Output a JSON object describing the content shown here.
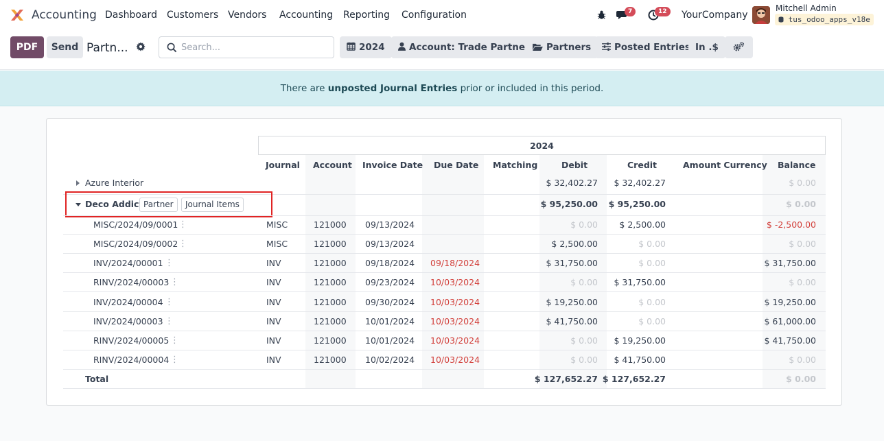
{
  "navbar": {
    "app_name": "Accounting",
    "menu": [
      "Dashboard",
      "Customers",
      "Vendors",
      "Accounting",
      "Reporting",
      "Configuration"
    ],
    "messages_count": "7",
    "activities_count": "12",
    "company": "YourCompany",
    "user": "Mitchell Admin",
    "database": "tus_odoo_apps_v18e"
  },
  "control_panel": {
    "pdf_label": "PDF",
    "send_label": "Send",
    "report_title": "Partn...",
    "search_placeholder": "Search...",
    "filters": {
      "date": "2024",
      "account": "Account: Trade Partners",
      "partners": "Partners",
      "posted": "Posted Entries",
      "currency": "In .$"
    }
  },
  "alert": {
    "prefix": "There are ",
    "bold": "unposted Journal Entries",
    "suffix": " prior or included in this period."
  },
  "report": {
    "period": "2024",
    "columns": [
      "Journal",
      "Account",
      "Invoice Date",
      "Due Date",
      "Matching",
      "Debit",
      "Credit",
      "Amount Currency",
      "Balance"
    ],
    "partners": [
      {
        "name": "Azure Interior",
        "debit": "$ 32,402.27",
        "credit": "$ 32,402.27",
        "balance": "$ 0.00"
      },
      {
        "name": "Deco Addict",
        "debit": "$ 95,250.00",
        "credit": "$ 95,250.00",
        "balance": "$ 0.00",
        "actions": [
          "Partner",
          "Journal Items"
        ]
      }
    ],
    "lines": [
      {
        "ref": "MISC/2024/09/0001",
        "journal": "MISC",
        "account": "121000",
        "invoice_date": "09/13/2024",
        "due_date": "",
        "debit": "$ 0.00",
        "credit": "$ 2,500.00",
        "balance": "$ -2,500.00"
      },
      {
        "ref": "MISC/2024/09/0002",
        "journal": "MISC",
        "account": "121000",
        "invoice_date": "09/13/2024",
        "due_date": "",
        "debit": "$ 2,500.00",
        "credit": "$ 0.00",
        "balance": "$ 0.00"
      },
      {
        "ref": "INV/2024/00001",
        "journal": "INV",
        "account": "121000",
        "invoice_date": "09/18/2024",
        "due_date": "09/18/2024",
        "debit": "$ 31,750.00",
        "credit": "$ 0.00",
        "balance": "$ 31,750.00"
      },
      {
        "ref": "RINV/2024/00003",
        "journal": "INV",
        "account": "121000",
        "invoice_date": "09/23/2024",
        "due_date": "10/03/2024",
        "debit": "$ 0.00",
        "credit": "$ 31,750.00",
        "balance": "$ 0.00"
      },
      {
        "ref": "INV/2024/00004",
        "journal": "INV",
        "account": "121000",
        "invoice_date": "09/30/2024",
        "due_date": "10/03/2024",
        "debit": "$ 19,250.00",
        "credit": "$ 0.00",
        "balance": "$ 19,250.00"
      },
      {
        "ref": "INV/2024/00003",
        "journal": "INV",
        "account": "121000",
        "invoice_date": "10/01/2024",
        "due_date": "10/03/2024",
        "debit": "$ 41,750.00",
        "credit": "$ 0.00",
        "balance": "$ 61,000.00"
      },
      {
        "ref": "RINV/2024/00005",
        "journal": "INV",
        "account": "121000",
        "invoice_date": "10/01/2024",
        "due_date": "10/03/2024",
        "debit": "$ 0.00",
        "credit": "$ 19,250.00",
        "balance": "$ 41,750.00"
      },
      {
        "ref": "RINV/2024/00004",
        "journal": "INV",
        "account": "121000",
        "invoice_date": "10/02/2024",
        "due_date": "10/03/2024",
        "debit": "$ 0.00",
        "credit": "$ 41,750.00",
        "balance": "$ 0.00"
      }
    ],
    "total": {
      "label": "Total",
      "debit": "$ 127,652.27",
      "credit": "$ 127,652.27",
      "balance": "$ 0.00"
    }
  },
  "colors": {
    "primary": "#714b67",
    "alert_bg": "#d4eef2",
    "negative": "#d23f3a",
    "badge": "#d44c59",
    "highlight": "#e02424"
  }
}
